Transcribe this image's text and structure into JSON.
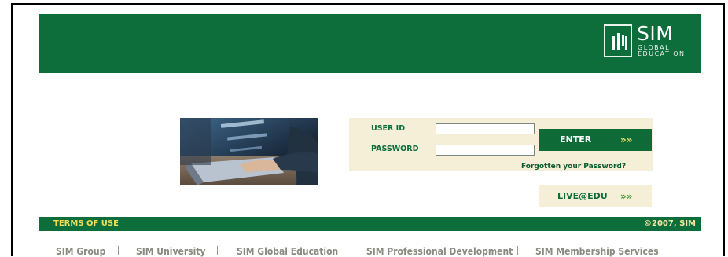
{
  "header": {
    "logo": {
      "name": "SIM",
      "line1": "GLOBAL",
      "line2": "EDUCATION"
    }
  },
  "login": {
    "user_id_label": "USER ID",
    "password_label": "PASSWORD",
    "user_id_value": "",
    "password_value": "",
    "enter_label": "ENTER",
    "enter_chevron": "»»",
    "forgot_label": "Forgotten your Password?",
    "live_label": "LIVE@EDU",
    "live_chevron": "»»"
  },
  "footer": {
    "terms_label": "TERMS OF USE",
    "copyright": "©2007, SIM",
    "links": [
      {
        "label": "SIM Group"
      },
      {
        "label": "SIM University"
      },
      {
        "label": "SIM Global Education"
      },
      {
        "label": "SIM Professional Development"
      },
      {
        "label": "SIM Membership Services"
      }
    ]
  },
  "colors": {
    "brand_green": "#0d6d3b",
    "panel_cream": "#f5efd7",
    "accent_yellow": "#f0dd55"
  }
}
